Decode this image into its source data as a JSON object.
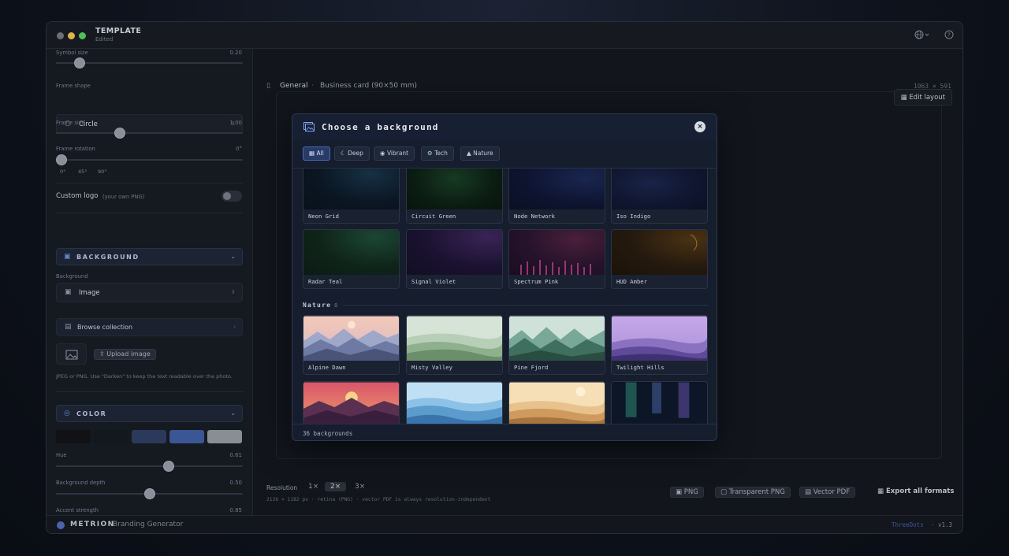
{
  "window": {
    "title": "TEMPLATE",
    "subtitle": "Edited"
  },
  "sidebar": {
    "symbol_size": {
      "label": "Symbol size",
      "value": "0.20",
      "level": 0.12
    },
    "frame_shape": {
      "label": "Frame shape",
      "value": "Circle"
    },
    "frame_size": {
      "label": "Frame size",
      "value": "1.00",
      "level": 0.35
    },
    "frame_rotation": {
      "label": "Frame rotation",
      "value": "0°",
      "level": 0.0,
      "presets": [
        "0°",
        "45°",
        "90°"
      ]
    },
    "custom_logo": {
      "label": "Custom logo",
      "hint": "(your own PNG)",
      "enabled": false
    },
    "background_section": {
      "title": "BACKGROUND"
    },
    "background": {
      "label": "Background",
      "value": "Image"
    },
    "browse": {
      "label": "Browse collection"
    },
    "upload": {
      "label": "Upload image"
    },
    "upload_hint": "JPEG or PNG. Use \"Darken\" to keep the text readable over the photo.",
    "color_section": {
      "title": "COLOR"
    },
    "swatches": [
      "#101216",
      "#14171d",
      "#2b3a5c",
      "#3a5694",
      "#8a8d92"
    ],
    "hue": {
      "label": "Hue",
      "value": "0.61",
      "level": 0.61
    },
    "background_depth": {
      "label": "Background depth",
      "value": "0.50",
      "level": 0.5
    },
    "accent_strength": {
      "label": "Accent strength",
      "value": "0.85",
      "level": 0.85
    }
  },
  "header": {
    "breadcrumb_root": "General",
    "separator": "·",
    "breadcrumb_item": "Business card (90×50 mm)",
    "dimensions": "1063 × 591"
  },
  "canvas": {
    "edit_layout": "Edit layout"
  },
  "export": {
    "resolution_label": "Resolution",
    "resolutions": [
      "1×",
      "2×",
      "3×"
    ],
    "selected_resolution": "2×",
    "resolution_info": "2126 × 1182 px · retina (PNG) · vector PDF is always resolution-independent",
    "formats": [
      "PNG",
      "Transparent PNG",
      "Vector PDF"
    ],
    "export_all": "Export all formats"
  },
  "footer": {
    "brand": "METRION",
    "product": "Branding Generator",
    "link": "ThreeDots",
    "separator": "·",
    "version": "v1.3"
  },
  "modal": {
    "title": "Choose a background",
    "filters": [
      "All",
      "Deep",
      "Vibrant",
      "Tech",
      "Nature"
    ],
    "active_filter": "All",
    "tech_tiles": [
      "Neon Grid",
      "Circuit Green",
      "Node Network",
      "Iso Indigo",
      "Radar Teal",
      "Signal Violet",
      "Spectrum Pink",
      "HUD Amber"
    ],
    "nature_section": {
      "title": "Nature",
      "count": "8"
    },
    "nature_tiles": [
      "Alpine Dawn",
      "Misty Valley",
      "Pine Fjord",
      "Twilight Hills"
    ],
    "count_label": "36 backgrounds"
  }
}
